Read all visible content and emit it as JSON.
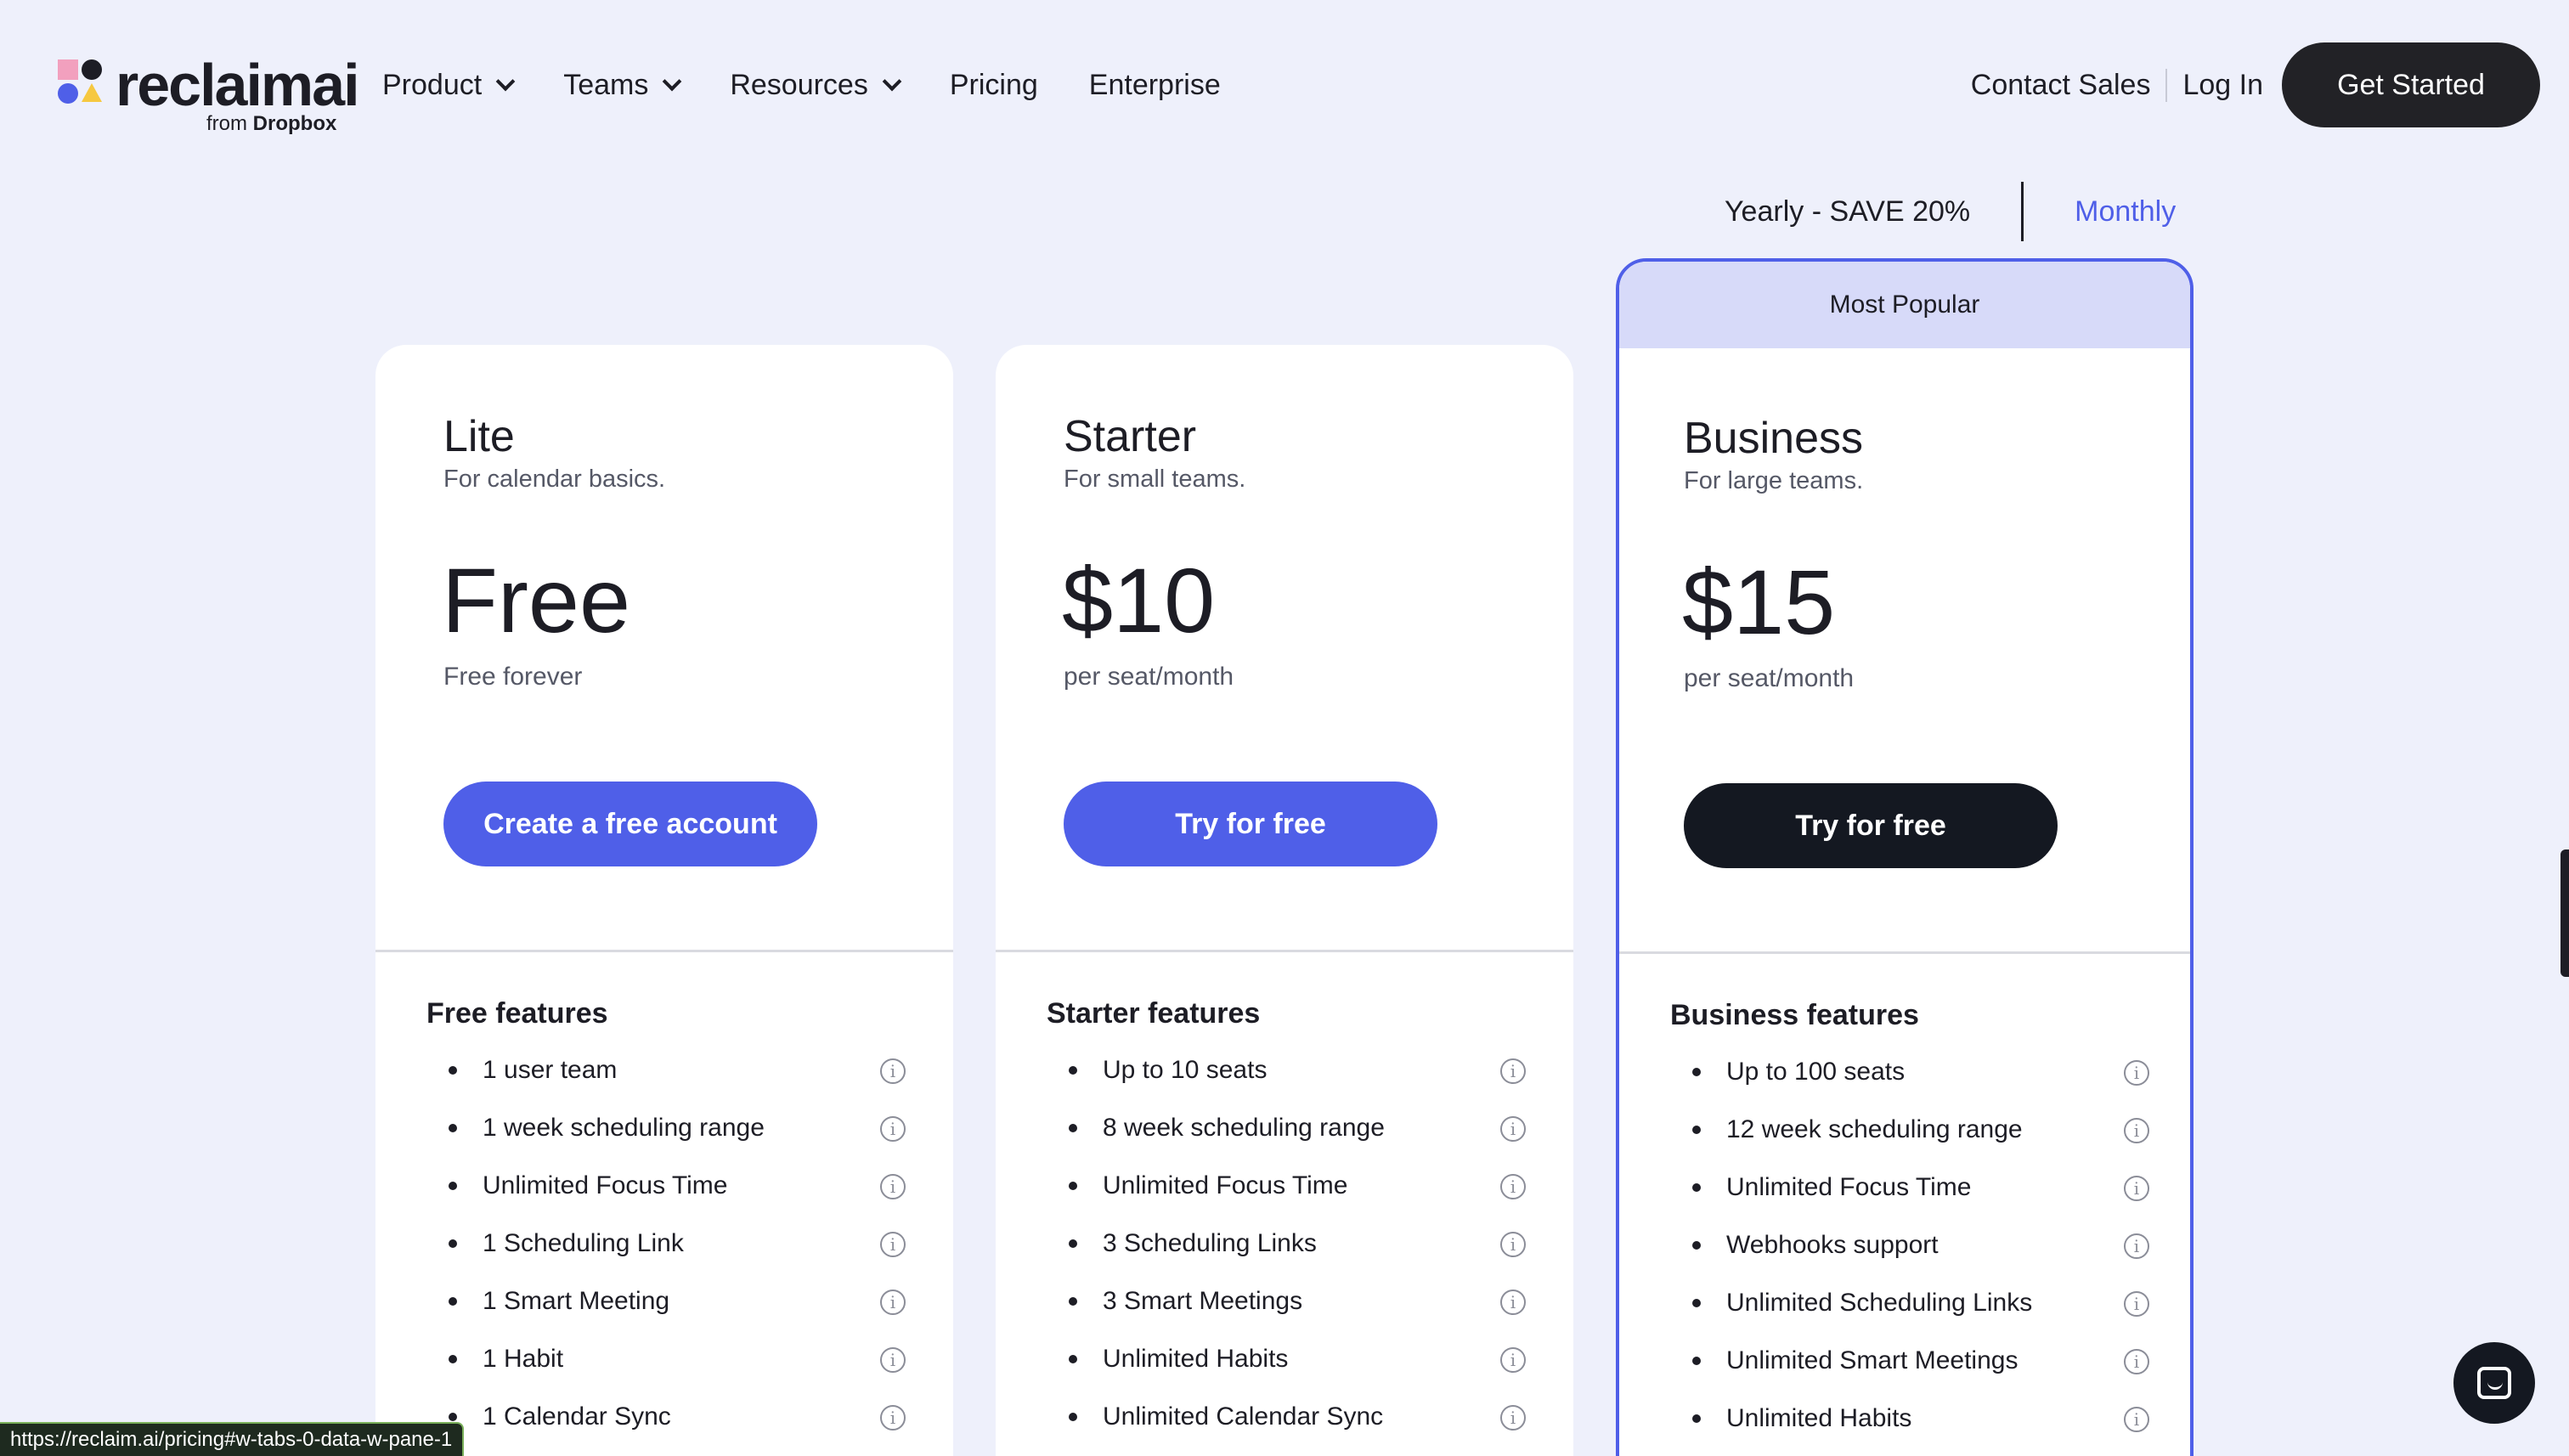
{
  "header": {
    "logo": {
      "word": "reclaimai",
      "sub_prefix": "from",
      "sub_brand": "Dropbox"
    },
    "nav": [
      {
        "label": "Product",
        "dropdown": true
      },
      {
        "label": "Teams",
        "dropdown": true
      },
      {
        "label": "Resources",
        "dropdown": true
      },
      {
        "label": "Pricing",
        "dropdown": false
      },
      {
        "label": "Enterprise",
        "dropdown": false
      }
    ],
    "contact_sales": "Contact Sales",
    "log_in": "Log In",
    "get_started": "Get Started"
  },
  "billing_toggle": {
    "yearly": "Yearly - SAVE 20%",
    "monthly": "Monthly",
    "selected": "Monthly"
  },
  "plans": [
    {
      "name": "Lite",
      "description": "For calendar basics.",
      "price": "Free",
      "period": "Free forever",
      "cta": "Create a free account",
      "features_title": "Free features",
      "features": [
        "1 user team",
        "1 week scheduling range",
        "Unlimited Focus Time",
        "1 Scheduling Link",
        "1 Smart Meeting",
        "1 Habit",
        "1 Calendar Sync"
      ]
    },
    {
      "name": "Starter",
      "description": "For small teams.",
      "price": "$10",
      "period": "per seat/month",
      "cta": "Try for free",
      "features_title": "Starter features",
      "features": [
        "Up to 10 seats",
        "8 week scheduling range",
        "Unlimited Focus Time",
        "3 Scheduling Links",
        "3 Smart Meetings",
        "Unlimited Habits",
        "Unlimited Calendar Sync"
      ]
    },
    {
      "badge": "Most Popular",
      "name": "Business",
      "description": "For large teams.",
      "price": "$15",
      "period": "per seat/month",
      "cta": "Try for free",
      "features_title": "Business features",
      "features": [
        "Up to 100 seats",
        "12 week scheduling range",
        "Unlimited Focus Time",
        "Webhooks support",
        "Unlimited Scheduling Links",
        "Unlimited Smart Meetings",
        "Unlimited Habits"
      ]
    }
  ],
  "status_url": "https://reclaim.ai/pricing#w-tabs-0-data-w-pane-1",
  "colors": {
    "accent": "#4f5fe8",
    "background": "#eef0fb",
    "dark": "#141821",
    "badge_bg": "#d7daf9"
  },
  "icons": {
    "info": "info-circle-icon",
    "chat": "chat-icon",
    "dropdown": "chevron-down-icon"
  }
}
